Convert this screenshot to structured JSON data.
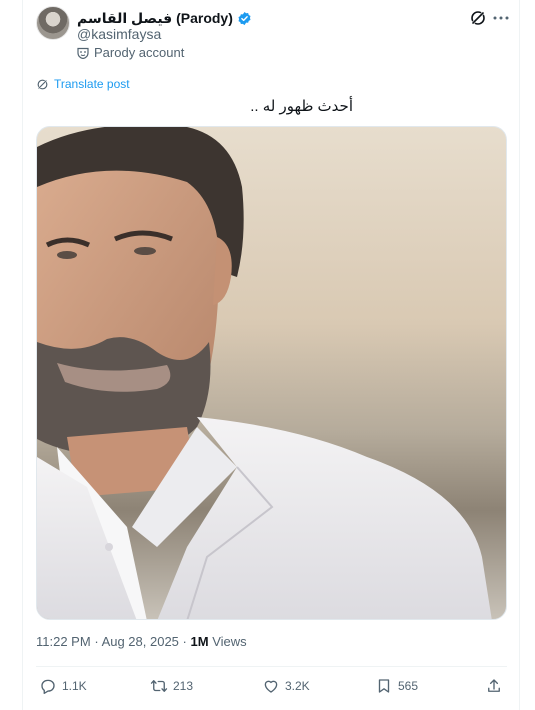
{
  "author": {
    "display_name": "فيصل القاسم (Parody)",
    "handle": "@kasimfaysa",
    "label": "Parody account",
    "verified": true,
    "verified_color": "#1d9bf0"
  },
  "translate_label": "Translate post",
  "post_text": "أحدث ظهور له ..",
  "image_description_icon": "portrait-photo",
  "meta": {
    "time": "11:22 PM",
    "separator": "·",
    "date": "Aug 28, 2025",
    "views_count": "1M",
    "views_label": "Views"
  },
  "actions": {
    "replies": "1.1K",
    "reposts": "213",
    "likes": "3.2K",
    "bookmarks": "565"
  },
  "colors": {
    "accent": "#1d9bf0",
    "text_secondary": "#536471"
  }
}
